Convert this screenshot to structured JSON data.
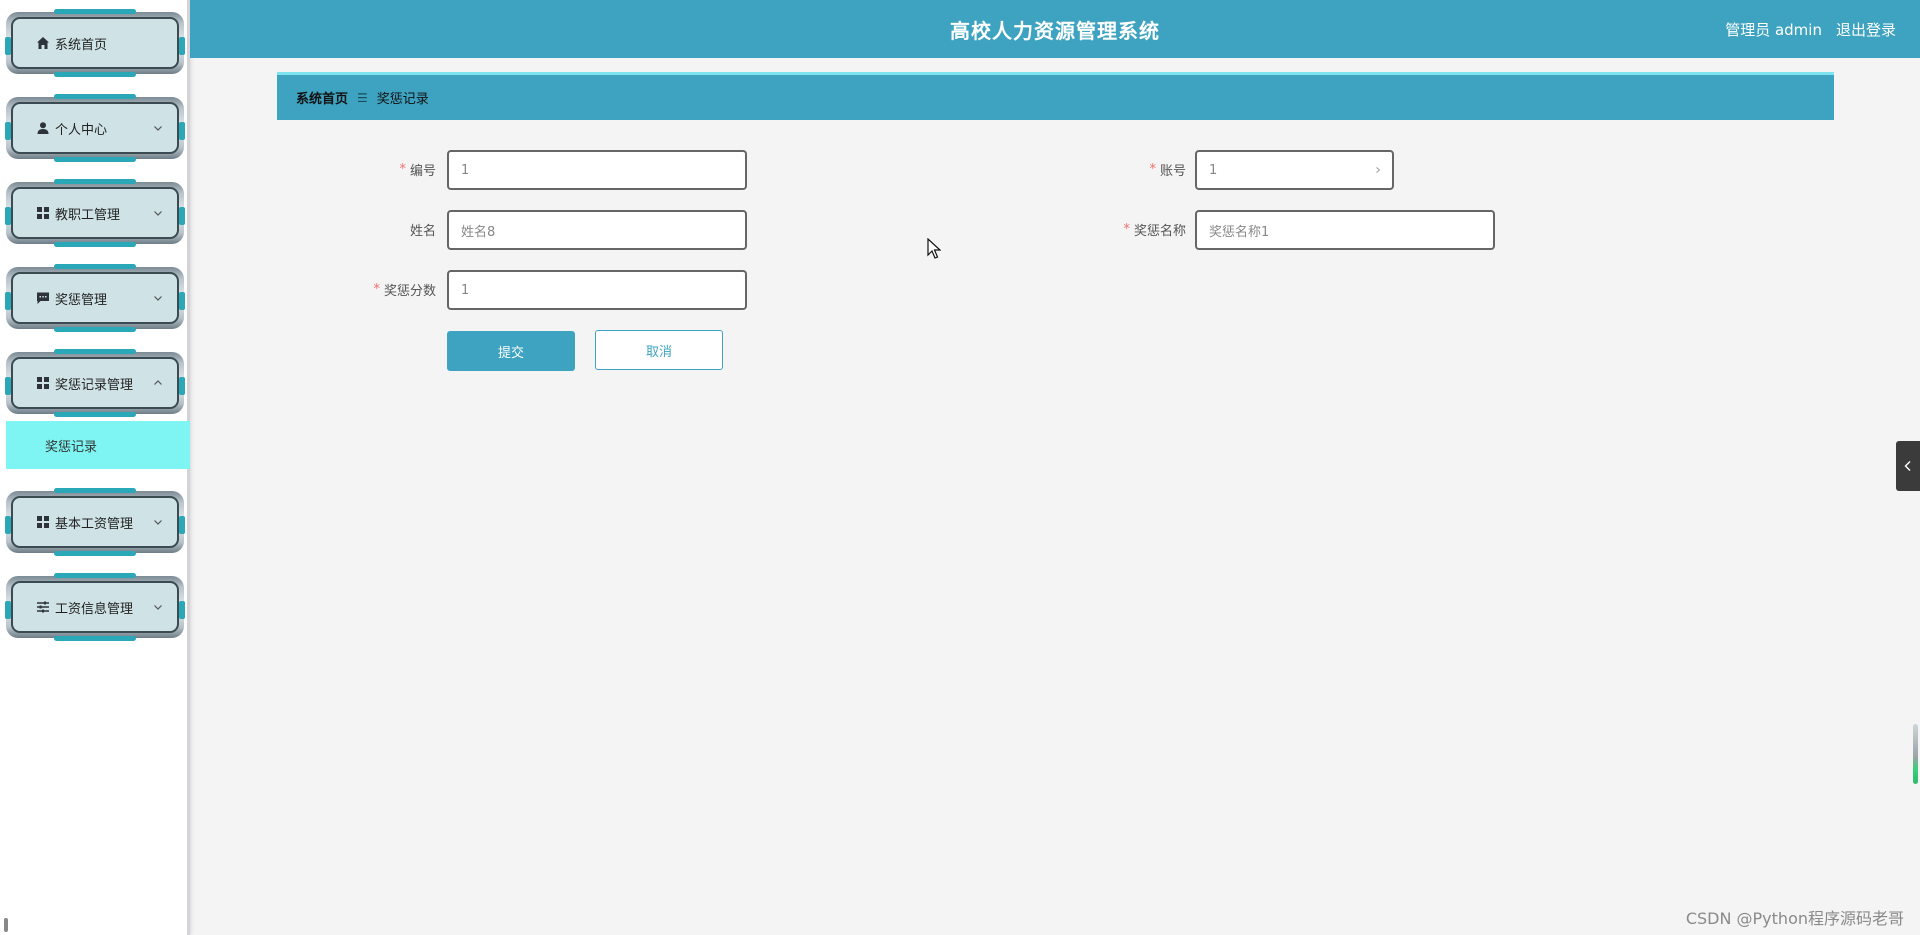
{
  "sidebar": {
    "items": [
      {
        "label": "系统首页",
        "icon": "home-icon",
        "has_chevron": false
      },
      {
        "label": "个人中心",
        "icon": "user-icon",
        "has_chevron": true
      },
      {
        "label": "教职工管理",
        "icon": "grid-icon",
        "has_chevron": true
      },
      {
        "label": "奖惩管理",
        "icon": "message-icon",
        "has_chevron": true
      },
      {
        "label": "奖惩记录管理",
        "icon": "grid-icon",
        "has_chevron": true,
        "expanded": true
      },
      {
        "label": "基本工资管理",
        "icon": "grid-icon",
        "has_chevron": true
      },
      {
        "label": "工资信息管理",
        "icon": "sliders-icon",
        "has_chevron": true
      }
    ],
    "active_submenu": {
      "label": "奖惩记录"
    }
  },
  "header": {
    "title": "高校人力资源管理系统",
    "user": "管理员 admin",
    "logout": "退出登录"
  },
  "breadcrumb": {
    "home": "系统首页",
    "separator": "☰",
    "current": "奖惩记录"
  },
  "form": {
    "bianhao": {
      "label": "编号",
      "value": "1",
      "required": true
    },
    "zhanghao": {
      "label": "账号",
      "value": "1",
      "required": true
    },
    "xingming": {
      "label": "姓名",
      "value": "姓名8",
      "required": false
    },
    "jiangchengmingcheng": {
      "label": "奖惩名称",
      "value": "奖惩名称1",
      "required": true
    },
    "jiangchengfenshu": {
      "label": "奖惩分数",
      "value": "1",
      "required": true
    },
    "submit_label": "提交",
    "cancel_label": "取消"
  },
  "watermark": "CSDN @Python程序源码老哥",
  "colors": {
    "accent": "#3ea3c0",
    "active_submenu": "#7ef5f2",
    "required": "#f56c6c"
  }
}
